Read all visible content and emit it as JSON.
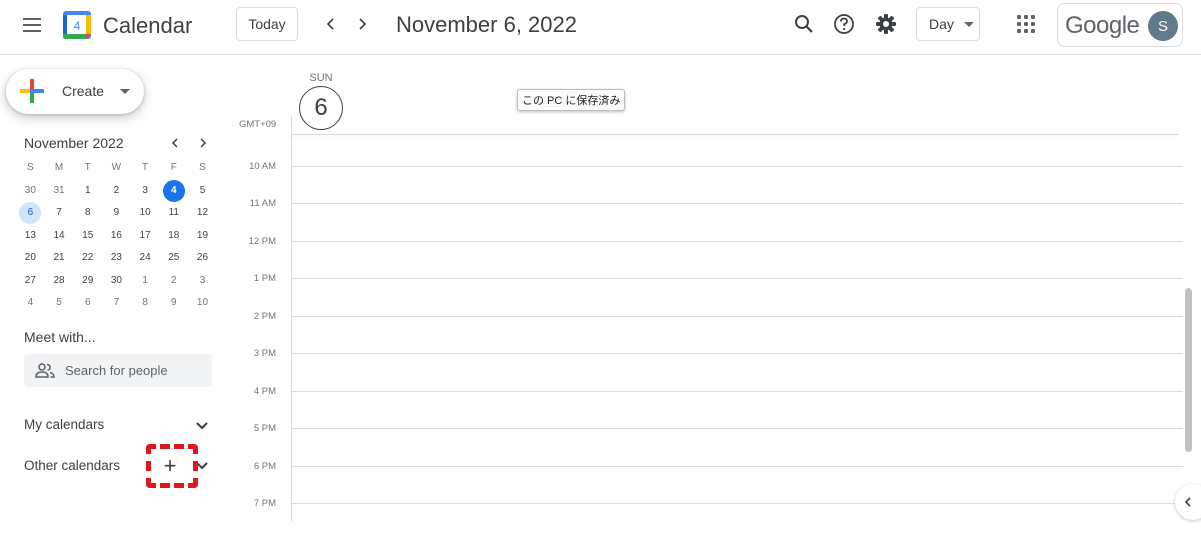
{
  "header": {
    "app_title": "Calendar",
    "logo_day": "4",
    "today_label": "Today",
    "date_title": "November 6, 2022",
    "view_label": "Day",
    "brand_word": "Google",
    "avatar_initial": "S"
  },
  "sidebar": {
    "create_label": "Create",
    "mini_month_title": "November 2022",
    "weekday_headers": [
      "S",
      "M",
      "T",
      "W",
      "T",
      "F",
      "S"
    ],
    "weeks": [
      [
        "30",
        "31",
        "1",
        "2",
        "3",
        "4",
        "5"
      ],
      [
        "6",
        "7",
        "8",
        "9",
        "10",
        "11",
        "12"
      ],
      [
        "13",
        "14",
        "15",
        "16",
        "17",
        "18",
        "19"
      ],
      [
        "20",
        "21",
        "22",
        "23",
        "24",
        "25",
        "26"
      ],
      [
        "27",
        "28",
        "29",
        "30",
        "1",
        "2",
        "3"
      ],
      [
        "4",
        "5",
        "6",
        "7",
        "8",
        "9",
        "10"
      ]
    ],
    "today_date": "4",
    "selected_date": "6",
    "meet_title": "Meet with...",
    "search_people_placeholder": "Search for people",
    "my_calendars_label": "My calendars",
    "other_calendars_label": "Other calendars",
    "add_other_calendar_glyph": "+"
  },
  "day_view": {
    "day_of_week": "SUN",
    "day_number": "6",
    "timezone_label": "GMT+09",
    "hour_labels": [
      "10 AM",
      "11 AM",
      "12 PM",
      "1 PM",
      "2 PM",
      "3 PM",
      "4 PM",
      "5 PM",
      "6 PM",
      "7 PM"
    ],
    "tooltip_text": "この PC に保存済み"
  },
  "colors": {
    "accent_blue": "#1a73e8",
    "selected_day_bg": "#d2e3fc",
    "highlight_red": "#e0161a",
    "logo_blue": "#4285f4",
    "logo_red": "#ea4335",
    "logo_yellow": "#fbbc04",
    "logo_green": "#34a853"
  },
  "icons": {
    "menu": "hamburger-menu-icon",
    "prev": "chevron-left-icon",
    "next": "chevron-right-icon",
    "search": "search-icon",
    "help": "help-icon",
    "settings": "gear-icon",
    "apps": "apps-grid-icon",
    "people": "people-icon"
  }
}
